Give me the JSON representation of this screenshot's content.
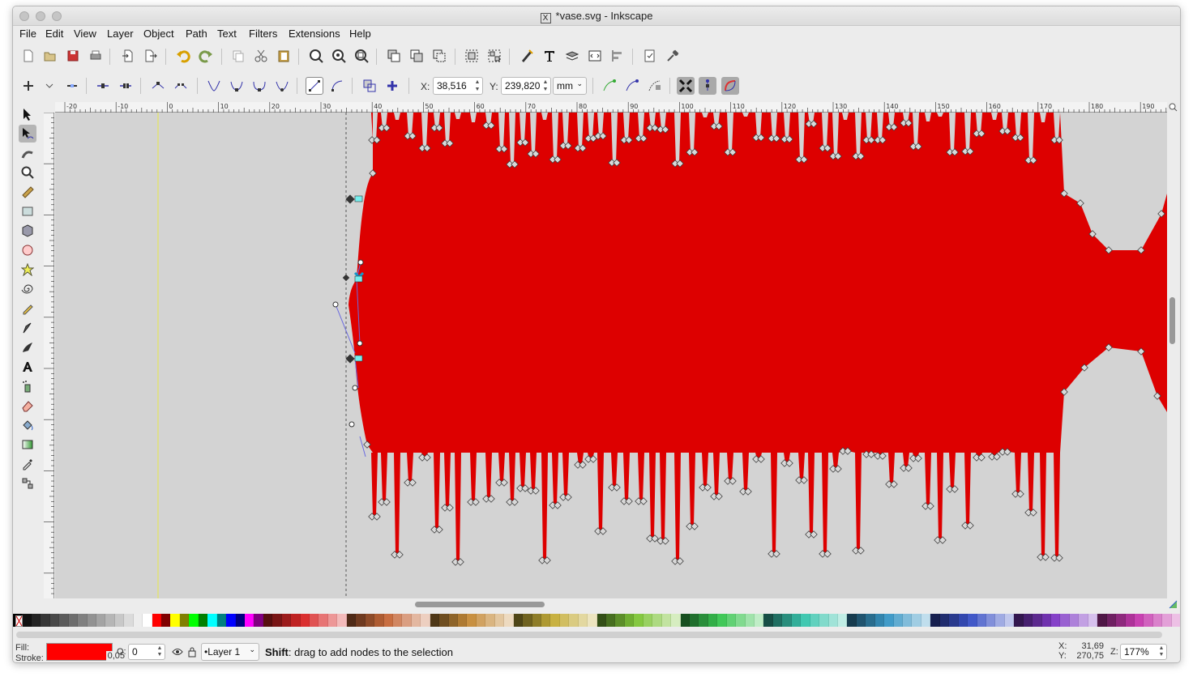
{
  "window": {
    "title": "*vase.svg - Inkscape"
  },
  "menu": [
    "File",
    "Edit",
    "View",
    "Layer",
    "Object",
    "Path",
    "Text",
    "Filters",
    "Extensions",
    "Help"
  ],
  "node_toolbar": {
    "x_label": "X:",
    "x_value": "38,516",
    "y_label": "Y:",
    "y_value": "239,820",
    "unit": "mm"
  },
  "ruler_h_labels": [
    "-20",
    "-10",
    "0",
    "10",
    "20",
    "30",
    "40",
    "50",
    "60",
    "70",
    "80",
    "90",
    "100",
    "110",
    "120",
    "130",
    "140",
    "150",
    "160",
    "170",
    "180",
    "190"
  ],
  "status": {
    "fill_label": "Fill:",
    "stroke_label": "Stroke:",
    "stroke_width": "0,05",
    "opacity_label": "O:",
    "opacity_value": "0",
    "layer": "•Layer 1",
    "message_bold": "Shift",
    "message": ": drag to add nodes to the selection",
    "cursor_x_label": "X:",
    "cursor_x": "31,69",
    "cursor_y_label": "Y:",
    "cursor_y": "270,75",
    "zoom_label": "Z:",
    "zoom": "177%"
  },
  "colors": {
    "fill": "#ff0000",
    "shape": "#dd0000",
    "canvas": "#d3d3d3",
    "page_border": "#e8e84a"
  }
}
